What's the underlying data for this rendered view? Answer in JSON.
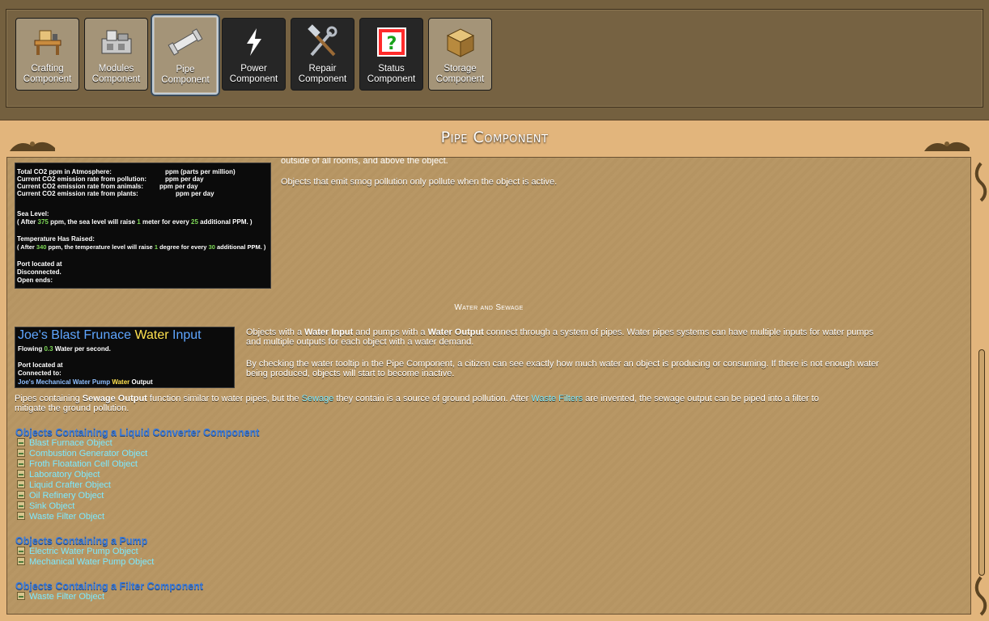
{
  "toolbar": {
    "items": [
      {
        "label1": "Crafting",
        "label2": "Component",
        "icon": "crafting-table-icon"
      },
      {
        "label1": "Modules",
        "label2": "Component",
        "icon": "modules-icon"
      },
      {
        "label1": "Pipe",
        "label2": "Component",
        "icon": "pipe-icon"
      },
      {
        "label1": "Power",
        "label2": "Component",
        "icon": "lightning-icon"
      },
      {
        "label1": "Repair",
        "label2": "Component",
        "icon": "hammer-wrench-icon"
      },
      {
        "label1": "Status",
        "label2": "Component",
        "icon": "question-mark-icon"
      },
      {
        "label1": "Storage",
        "label2": "Component",
        "icon": "storage-crate-icon"
      }
    ]
  },
  "page": {
    "title": "Pipe Component",
    "cut_text": "outside of all rooms, and above the object.",
    "smog_text": "Objects that emit smog pollution only pollute when the object is active.",
    "co2_tooltip": {
      "l1a": "Total CO2 ppm in Atmosphere:",
      "l1b": "ppm (parts per million)",
      "l2a": "Current CO2 emission rate from pollution:",
      "l2b": "ppm per day",
      "l3a": "Current CO2 emission rate from animals:",
      "l3b": "ppm per day",
      "l4a": "Current CO2 emission rate from plants:",
      "l4b": "ppm per day",
      "sea_hdr": "Sea Level:",
      "sea_a": "( After",
      "sea_n1": "375",
      "sea_b": "ppm, the sea level will raise",
      "sea_n2": "1",
      "sea_c": "meter for every",
      "sea_n3": "25",
      "sea_d": "additional PPM. )",
      "temp_hdr": "Temperature Has Raised:",
      "temp_a": "( After",
      "temp_n1": "340",
      "temp_b": "ppm, the temperature level will raise",
      "temp_n2": "1",
      "temp_c": "degree for every",
      "temp_n3": "30",
      "temp_d": "additional PPM. )",
      "port": "Port located at",
      "disc": "Disconnected.",
      "open": "Open ends:"
    },
    "section_title": "Water and Sewage",
    "water_tooltip": {
      "title_a": "Joe's Blast Frunace",
      "title_b": "Water",
      "title_c": "Input",
      "flow_a": "Flowing",
      "flow_n": "0.3",
      "flow_b": "Water per second.",
      "port": "Port located at",
      "conn": "Connected to:",
      "pump": "Joe's Mechanical Water Pump",
      "pump_b": "Water",
      "pump_c": "Output"
    },
    "para1_a": "Objects with a ",
    "para1_b": "Water Input",
    "para1_c": " and pumps with a ",
    "para1_d": "Water Output",
    "para1_e": " connect through a system of pipes. Water pipes systems can have multiple inputs for water pumps",
    "para1_f": "and multiple outputs for each object with a water demand.",
    "para2_a": "By checking the water tooltip in the Pipe Component, a citizen can see exactly how much water an object is producing or consuming. If there is not enough water",
    "para2_b": "being produced, objects will start to become inactive.",
    "para3_a": "Pipes containing ",
    "para3_b": "Sewage Output",
    "para3_c": " function similar to water pipes, but the ",
    "para3_link1": "Sewage",
    "para3_d": " they contain is a source of ground pollution. After ",
    "para3_link2": "Waste Filters",
    "para3_e": " are invented, the sewage output can be piped into a filter to",
    "para3_f": "mitigate the ground pollution.",
    "groups": [
      {
        "header": "Objects Containing a Liquid Converter Component",
        "items": [
          "Blast Furnace Object",
          "Combustion Generator Object",
          "Froth Floatation Cell Object",
          "Laboratory Object",
          "Liquid Crafter Object",
          "Oil Refinery Object",
          "Sink Object",
          "Waste Filter Object"
        ]
      },
      {
        "header": "Objects Containing a Pump",
        "items": [
          "Electric Water Pump Object",
          "Mechanical Water Pump Object"
        ]
      },
      {
        "header": "Objects Containing a Filter Component",
        "items": [
          "Waste Filter Object"
        ]
      }
    ]
  },
  "colors": {
    "accent_blue": "#3d7bd8",
    "link_cyan": "#7ce9ff",
    "parchment": "#e2b57c"
  }
}
